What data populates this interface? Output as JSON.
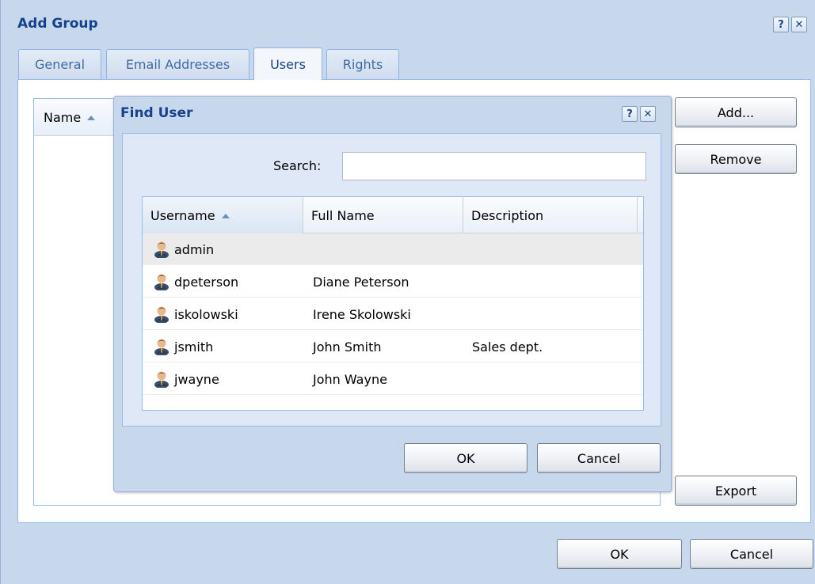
{
  "dialog": {
    "title": "Add Group",
    "help_label": "?",
    "close_label": "✕",
    "tabs": [
      {
        "label": "General"
      },
      {
        "label": "Email Addresses"
      },
      {
        "label": "Users"
      },
      {
        "label": "Rights"
      }
    ],
    "members_grid": {
      "columns": [
        {
          "label": "Name"
        }
      ]
    },
    "side_buttons": {
      "add": "Add...",
      "remove": "Remove",
      "export": "Export"
    },
    "footer": {
      "ok": "OK",
      "cancel": "Cancel"
    }
  },
  "find_user": {
    "title": "Find User",
    "help_label": "?",
    "close_label": "✕",
    "search": {
      "label": "Search:",
      "value": "",
      "placeholder": ""
    },
    "columns": [
      {
        "label": "Username"
      },
      {
        "label": "Full Name"
      },
      {
        "label": "Description"
      }
    ],
    "rows": [
      {
        "username": "admin",
        "full_name": "",
        "description": ""
      },
      {
        "username": "dpeterson",
        "full_name": "Diane Peterson",
        "description": ""
      },
      {
        "username": "iskolowski",
        "full_name": "Irene Skolowski",
        "description": ""
      },
      {
        "username": "jsmith",
        "full_name": "John Smith",
        "description": "Sales dept."
      },
      {
        "username": "jwayne",
        "full_name": "John Wayne",
        "description": ""
      }
    ],
    "buttons": {
      "ok": "OK",
      "cancel": "Cancel"
    },
    "row_icon": "user-icon"
  },
  "colors": {
    "window_bg": "#c7d8ed",
    "title_text": "#15428b",
    "panel_border": "#99bbe8",
    "body_bg": "#dfe8f6"
  }
}
